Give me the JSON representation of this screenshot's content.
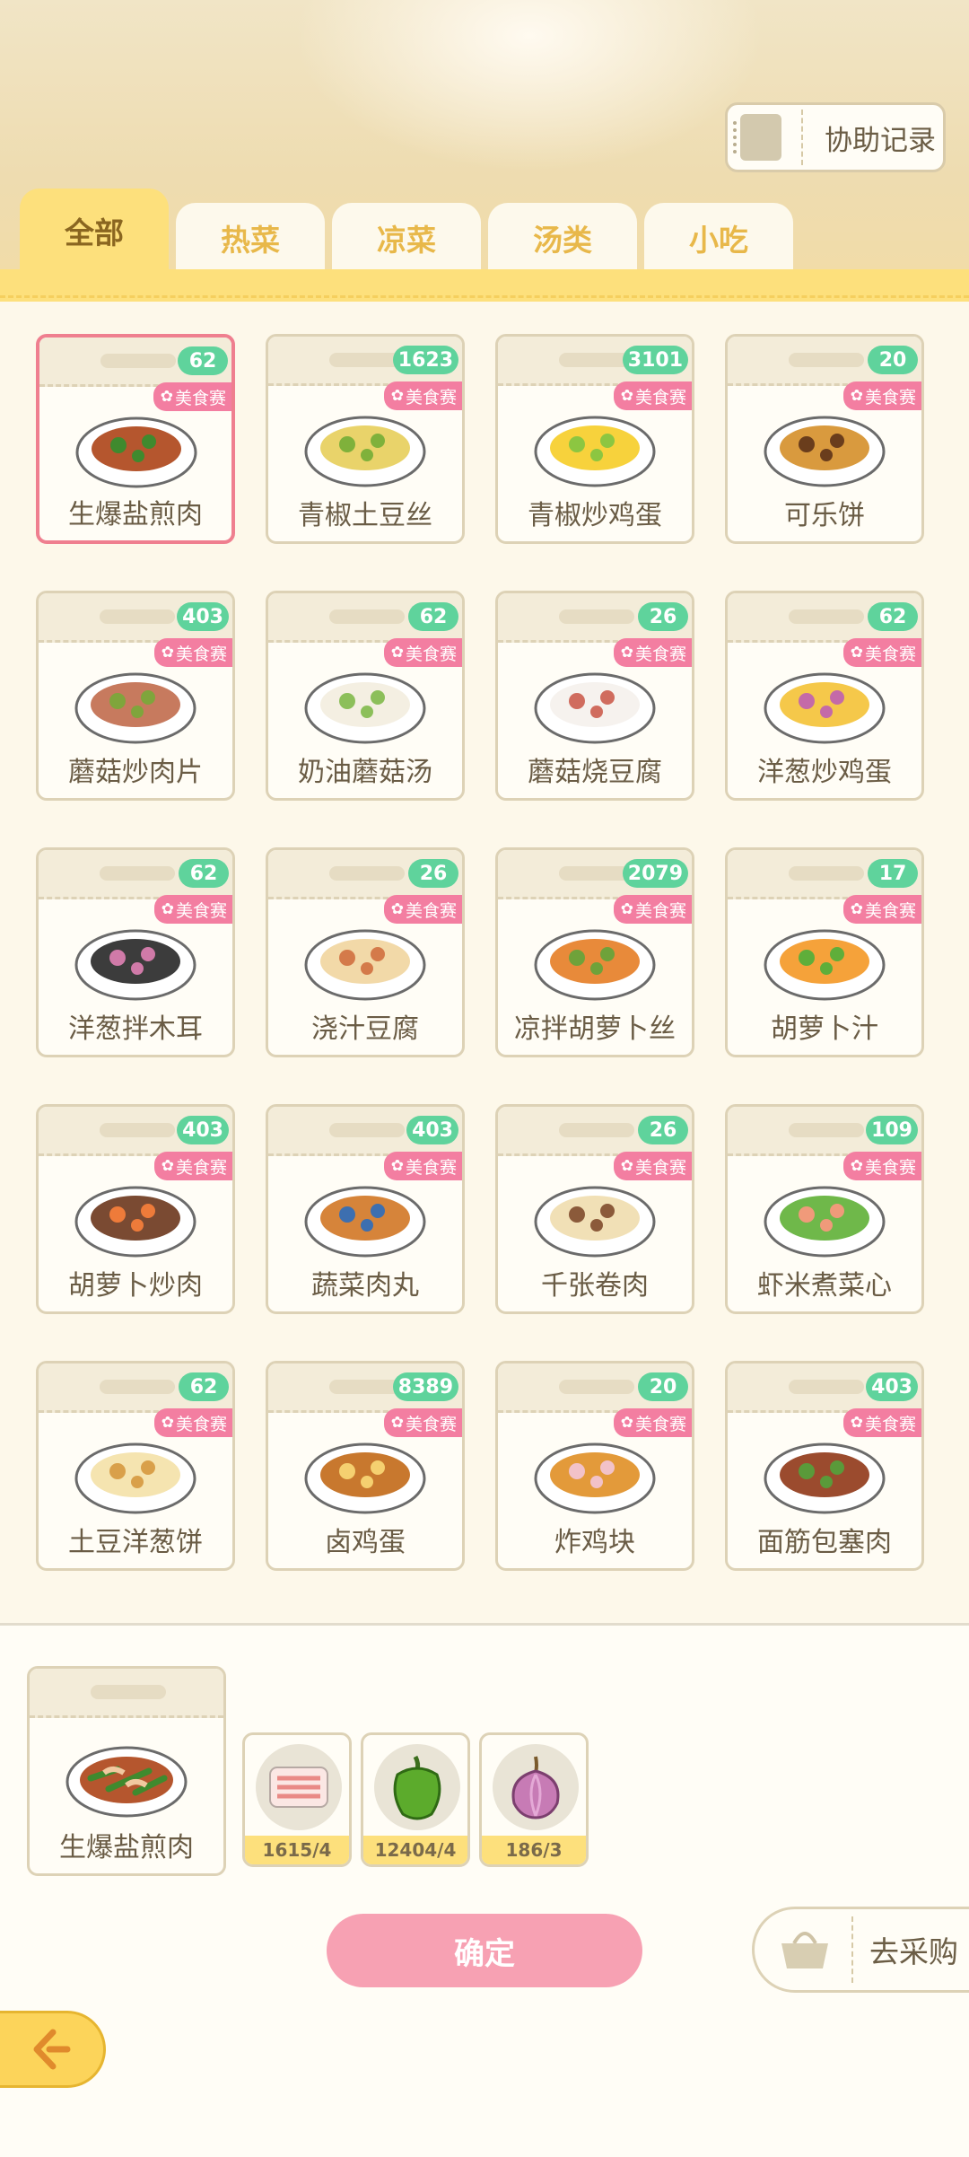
{
  "header": {
    "assist_label": "协助记录"
  },
  "tabs": [
    {
      "label": "全部",
      "active": true
    },
    {
      "label": "热菜",
      "active": false
    },
    {
      "label": "凉菜",
      "active": false
    },
    {
      "label": "汤类",
      "active": false
    },
    {
      "label": "小吃",
      "active": false
    }
  ],
  "badge_text": "美食赛",
  "dishes": [
    {
      "name": "生爆盐煎肉",
      "count": "62",
      "selected": true,
      "icon": "stir-fried-pork-icon"
    },
    {
      "name": "青椒土豆丝",
      "count": "1623",
      "icon": "potato-shreds-icon"
    },
    {
      "name": "青椒炒鸡蛋",
      "count": "3101",
      "icon": "pepper-egg-icon"
    },
    {
      "name": "可乐饼",
      "count": "20",
      "icon": "croquette-icon"
    },
    {
      "name": "蘑菇炒肉片",
      "count": "403",
      "icon": "mushroom-pork-icon"
    },
    {
      "name": "奶油蘑菇汤",
      "count": "62",
      "icon": "cream-soup-icon"
    },
    {
      "name": "蘑菇烧豆腐",
      "count": "26",
      "icon": "mushroom-tofu-icon"
    },
    {
      "name": "洋葱炒鸡蛋",
      "count": "62",
      "icon": "onion-egg-icon"
    },
    {
      "name": "洋葱拌木耳",
      "count": "62",
      "icon": "onion-fungus-icon"
    },
    {
      "name": "浇汁豆腐",
      "count": "26",
      "icon": "sauce-tofu-icon"
    },
    {
      "name": "凉拌胡萝卜丝",
      "count": "2079",
      "icon": "carrot-salad-icon"
    },
    {
      "name": "胡萝卜汁",
      "count": "17",
      "icon": "carrot-juice-icon"
    },
    {
      "name": "胡萝卜炒肉",
      "count": "403",
      "icon": "carrot-pork-icon"
    },
    {
      "name": "蔬菜肉丸",
      "count": "403",
      "icon": "meatball-icon"
    },
    {
      "name": "千张卷肉",
      "count": "26",
      "icon": "tofu-roll-icon"
    },
    {
      "name": "虾米煮菜心",
      "count": "109",
      "icon": "shrimp-greens-icon"
    },
    {
      "name": "土豆洋葱饼",
      "count": "62",
      "icon": "potato-pancake-icon"
    },
    {
      "name": "卤鸡蛋",
      "count": "8389",
      "icon": "braised-egg-icon"
    },
    {
      "name": "炸鸡块",
      "count": "20",
      "icon": "fried-chicken-icon"
    },
    {
      "name": "面筋包塞肉",
      "count": "403",
      "icon": "gluten-meat-icon"
    }
  ],
  "selection": {
    "name": "生爆盐煎肉",
    "ingredients": [
      {
        "qty": "1615/4",
        "icon": "pork-belly-icon"
      },
      {
        "qty": "12404/4",
        "icon": "green-pepper-icon"
      },
      {
        "qty": "186/3",
        "icon": "onion-icon"
      }
    ]
  },
  "actions": {
    "confirm_label": "确定",
    "shop_label": "去采购"
  },
  "colors": {
    "accent_yellow": "#fde07c",
    "count_green": "#5fd39c",
    "badge_pink": "#f37ea1",
    "confirm_pink": "#f7a1b3"
  }
}
